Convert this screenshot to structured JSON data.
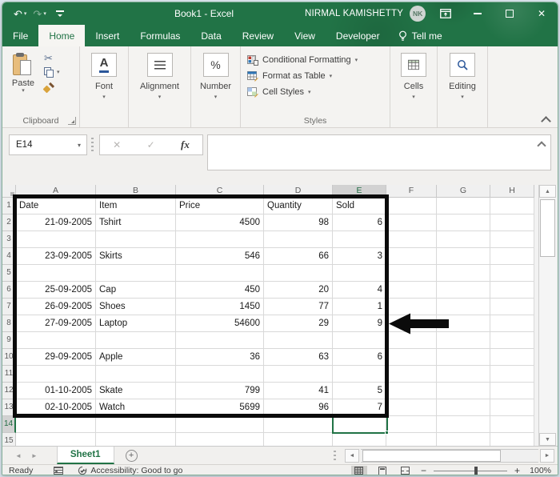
{
  "window": {
    "title": "Book1 - Excel",
    "user_name": "NIRMAL KAMISHETTY",
    "user_initials": "NK"
  },
  "tabs": {
    "items": [
      "File",
      "Home",
      "Insert",
      "Formulas",
      "Data",
      "Review",
      "View",
      "Developer"
    ],
    "active": "Home",
    "tell_me": "Tell me"
  },
  "ribbon": {
    "paste_label": "Paste",
    "clipboard_group": "Clipboard",
    "font_label": "Font",
    "font_icon_letter": "A",
    "alignment_label": "Alignment",
    "number_label": "Number",
    "number_icon": "%",
    "styles_items": [
      "Conditional Formatting",
      "Format as Table",
      "Cell Styles"
    ],
    "styles_group": "Styles",
    "cells_label": "Cells",
    "editing_label": "Editing"
  },
  "formula_bar": {
    "name_box": "E14",
    "fx_label": "fx",
    "formula_value": ""
  },
  "grid": {
    "columns": [
      "A",
      "B",
      "C",
      "D",
      "E",
      "F",
      "G",
      "H"
    ],
    "row_count": 15,
    "selection": {
      "cell": "E14",
      "column": "E",
      "row": 14
    },
    "align_by_column": {
      "A": "right",
      "B": "left",
      "C": "right",
      "D": "right",
      "E": "right"
    },
    "cells": [
      {
        "row": 1,
        "align": "left",
        "values": {
          "A": "Date",
          "B": "Item",
          "C": "Price",
          "D": "Quantity",
          "E": "Sold"
        }
      },
      {
        "row": 2,
        "values": {
          "A": "21-09-2005",
          "B": "Tshirt",
          "C": "4500",
          "D": "98",
          "E": "6"
        }
      },
      {
        "row": 4,
        "values": {
          "A": "23-09-2005",
          "B": "Skirts",
          "C": "546",
          "D": "66",
          "E": "3"
        }
      },
      {
        "row": 6,
        "values": {
          "A": "25-09-2005",
          "B": "Cap",
          "C": "450",
          "D": "20",
          "E": "4"
        }
      },
      {
        "row": 7,
        "values": {
          "A": "26-09-2005",
          "B": "Shoes",
          "C": "1450",
          "D": "77",
          "E": "1"
        }
      },
      {
        "row": 8,
        "values": {
          "A": "27-09-2005",
          "B": "Laptop",
          "C": "54600",
          "D": "29",
          "E": "9"
        }
      },
      {
        "row": 10,
        "values": {
          "A": "29-09-2005",
          "B": "Apple",
          "C": "36",
          "D": "63",
          "E": "6"
        }
      },
      {
        "row": 12,
        "values": {
          "A": "01-10-2005",
          "B": "Skate",
          "C": "799",
          "D": "41",
          "E": "5"
        }
      },
      {
        "row": 13,
        "values": {
          "A": "02-10-2005",
          "B": "Watch",
          "C": "5699",
          "D": "96",
          "E": "7"
        }
      }
    ],
    "annotation": {
      "border_range": "A1:E13",
      "arrow_points_to_row": 8
    }
  },
  "sheet_bar": {
    "active_sheet": "Sheet1"
  },
  "status_bar": {
    "mode": "Ready",
    "accessibility": "Accessibility: Good to go",
    "zoom_level": "100%"
  },
  "icons": {
    "undo": "↶",
    "redo": "↷",
    "dropdown": "▾",
    "close": "✕",
    "scissors": "✂",
    "cancel": "✕",
    "enter": "✓",
    "scroll_up": "▲",
    "scroll_down": "▼",
    "scroll_left": "◄",
    "scroll_right": "►",
    "add_sheet": "+",
    "zoom_out": "−",
    "zoom_in": "+"
  },
  "colors": {
    "accent_green": "#217346",
    "annotation_black": "#0b0b0b",
    "font_underline_blue": "#2b579a"
  }
}
